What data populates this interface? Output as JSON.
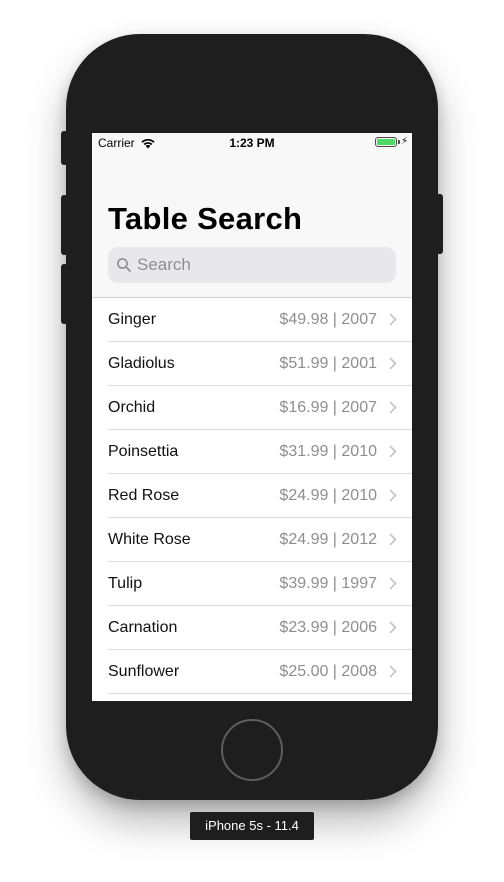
{
  "status_bar": {
    "carrier": "Carrier",
    "wifi_icon": "wifi-icon",
    "time": "1:23 PM",
    "battery_color": "#4cd964",
    "bolt": "⚡"
  },
  "nav": {
    "title": "Table Search"
  },
  "search": {
    "icon": "search-icon",
    "placeholder": "Search"
  },
  "rows": [
    {
      "name": "Ginger",
      "detail": "$49.98 | 2007"
    },
    {
      "name": "Gladiolus",
      "detail": "$51.99 | 2001"
    },
    {
      "name": "Orchid",
      "detail": "$16.99 | 2007"
    },
    {
      "name": "Poinsettia",
      "detail": "$31.99 | 2010"
    },
    {
      "name": "Red Rose",
      "detail": "$24.99 | 2010"
    },
    {
      "name": "White Rose",
      "detail": "$24.99 | 2012"
    },
    {
      "name": "Tulip",
      "detail": "$39.99 | 1997"
    },
    {
      "name": "Carnation",
      "detail": "$23.99 | 2006"
    },
    {
      "name": "Sunflower",
      "detail": "$25.00 | 2008"
    }
  ],
  "simulator_label": "iPhone 5s - 11.4"
}
